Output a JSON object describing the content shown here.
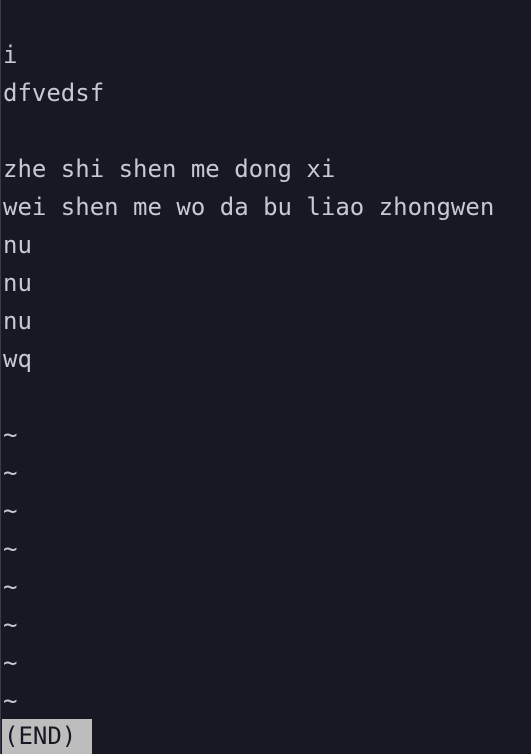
{
  "pager": {
    "lines": [
      "i",
      "dfvedsf",
      "",
      "zhe shi shen me dong xi",
      "wei shen me wo da bu liao zhongwen",
      "nu",
      "nu",
      "nu",
      "wq",
      ""
    ],
    "filler": [
      "~",
      "~",
      "~",
      "~",
      "~",
      "~",
      "~",
      "~"
    ],
    "status_text": "(END)"
  }
}
